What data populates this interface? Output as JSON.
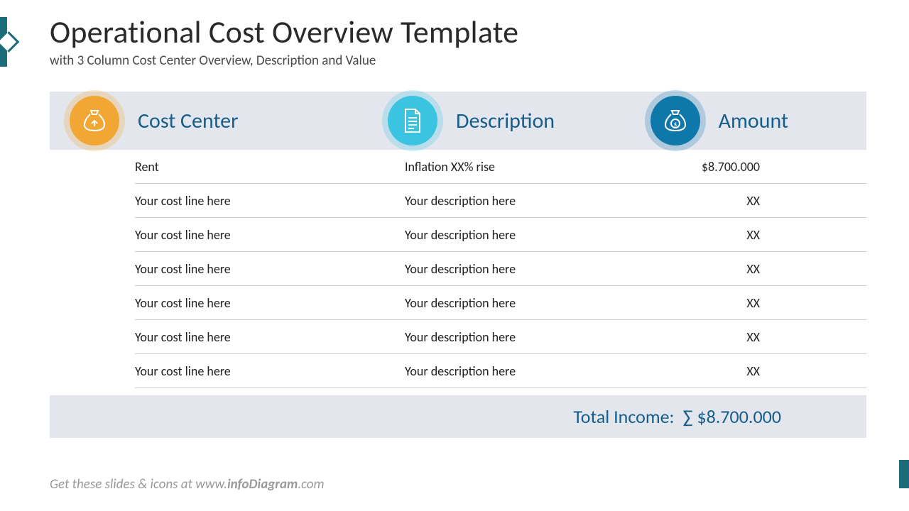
{
  "title": "Operational Cost Overview Template",
  "subtitle": "with 3 Column Cost Center Overview, Description and Value",
  "headers": {
    "col1": "Cost Center",
    "col2": "Description",
    "col3": "Amount"
  },
  "rows": [
    {
      "center": "Rent",
      "desc": "Inflation XX% rise",
      "amount": "$8.700.000"
    },
    {
      "center": "Your cost line here",
      "desc": "Your description here",
      "amount": "XX"
    },
    {
      "center": "Your cost line here",
      "desc": "Your description here",
      "amount": "XX"
    },
    {
      "center": "Your cost line here",
      "desc": "Your description here",
      "amount": "XX"
    },
    {
      "center": "Your cost line here",
      "desc": "Your description here",
      "amount": "XX"
    },
    {
      "center": "Your cost line here",
      "desc": "Your description here",
      "amount": "XX"
    },
    {
      "center": "Your cost line here",
      "desc": "Your description here",
      "amount": "XX"
    }
  ],
  "total": {
    "label": "Total Income:",
    "value": "∑ $8.700.000"
  },
  "footer_pre": "Get these slides & icons at www.",
  "footer_bold": "infoDiagram",
  "footer_post": ".com",
  "icons": {
    "cost_center": "money-bag-up-icon",
    "description": "document-icon",
    "amount": "money-bag-dollar-icon"
  }
}
